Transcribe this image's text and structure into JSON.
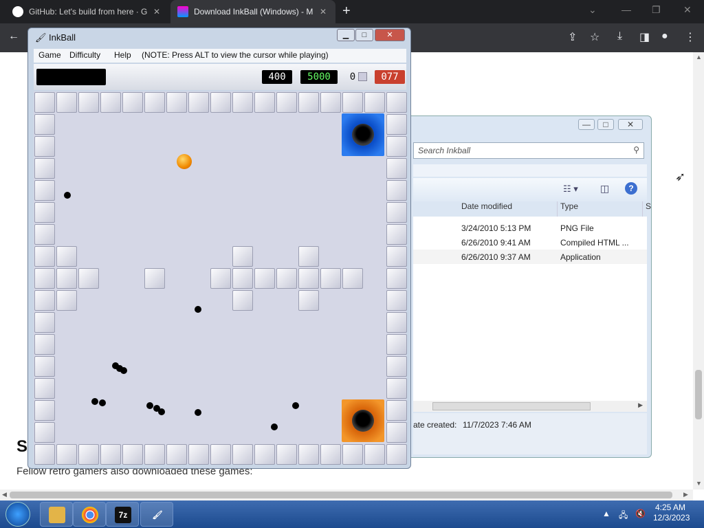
{
  "browser": {
    "tabs": [
      {
        "title": "GitHub: Let's build from here · G",
        "close": "✕",
        "icon": "github-icon"
      },
      {
        "title": "Download InkBall (Windows) - M",
        "close": "✕",
        "icon": "inkball-favicon"
      }
    ],
    "new_tab": "+",
    "page": {
      "heading": "Si",
      "subtext": "Fellow retro gamers also downloaded these games:"
    }
  },
  "explorer": {
    "search_placeholder": "Search Inkball",
    "columns": [
      "Date modified",
      "Type",
      "S"
    ],
    "rows": [
      {
        "date": "3/24/2010 5:13 PM",
        "type": "PNG File"
      },
      {
        "date": "6/26/2010 9:41 AM",
        "type": "Compiled HTML ..."
      },
      {
        "date": "6/26/2010 9:37 AM",
        "type": "Application"
      }
    ],
    "details": {
      "created": "ate created:",
      "created_value": "11/7/2023 7:46 AM"
    }
  },
  "inkball": {
    "title": "InkBall",
    "menu": {
      "game": "Game",
      "difficulty": "Difficulty",
      "help": "Help",
      "note": "(NOTE: Press ALT to view the cursor while playing)"
    },
    "scores": {
      "score": "400",
      "bonus": "5000",
      "balls": "0",
      "timer": "077"
    },
    "colors": {
      "timer_bg": "#c9402e",
      "bonus_text": "#66ff66"
    }
  },
  "taskbar": {
    "apps": [
      "explorer-icon",
      "chrome-icon",
      "7zip-icon",
      "inkball-icon"
    ],
    "time": "4:25 AM",
    "date": "12/3/2023"
  }
}
